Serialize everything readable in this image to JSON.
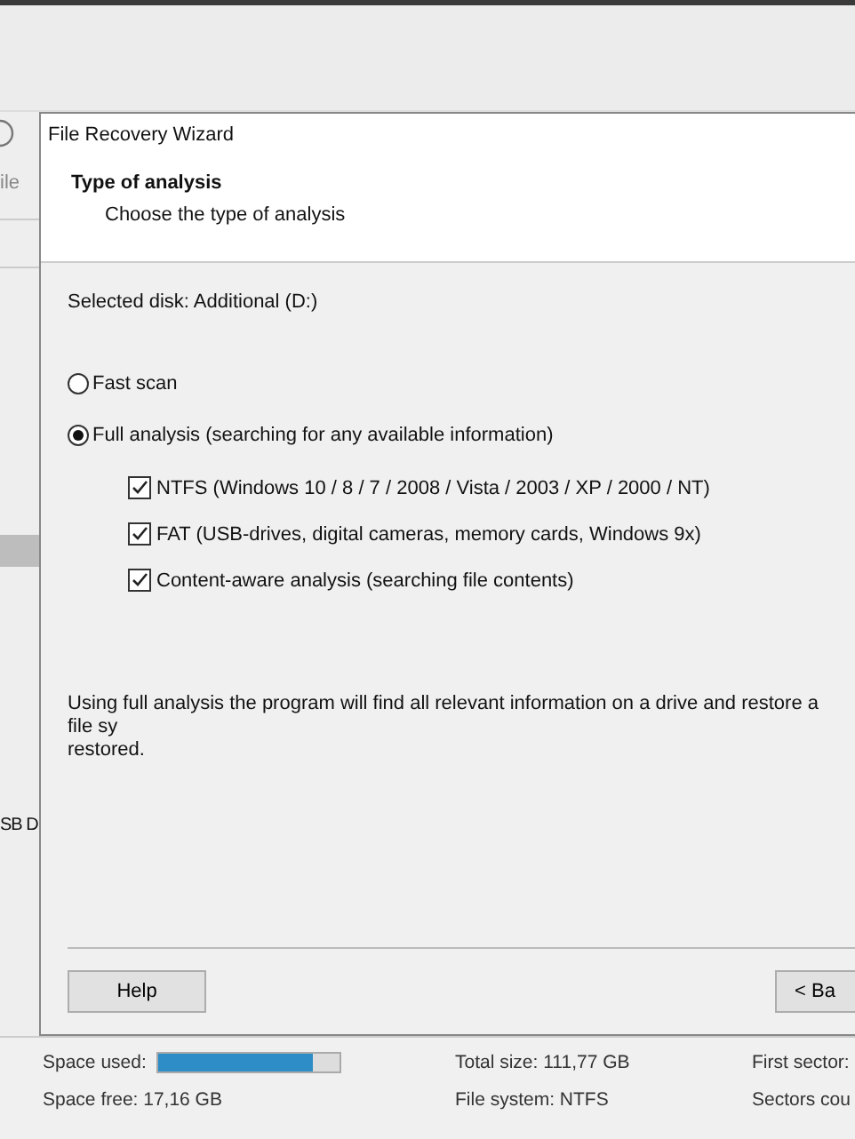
{
  "background": {
    "toolbar_text": "ile",
    "list_selected_row": true,
    "list_text": "SB D"
  },
  "dialog": {
    "title": "File Recovery Wizard",
    "heading": "Type of analysis",
    "subheading": "Choose the type of analysis",
    "selected_disk": "Selected disk: Additional (D:)",
    "options": [
      {
        "label": "Fast scan",
        "selected": false
      },
      {
        "label": "Full analysis (searching for any available information)",
        "selected": true
      }
    ],
    "filesystems": [
      {
        "label": "NTFS (Windows 10 / 8 / 7 / 2008 / Vista / 2003 / XP / 2000 / NT)",
        "checked": true
      },
      {
        "label": "FAT (USB-drives, digital cameras, memory cards, Windows 9x)",
        "checked": true
      },
      {
        "label": "Content-aware analysis (searching file contents)",
        "checked": true
      }
    ],
    "description": [
      "Using full analysis the program will find all relevant information on a drive and restore a file sy",
      "restored."
    ],
    "buttons": [
      "Help",
      "< Ba"
    ]
  },
  "status_bar": {
    "space_used_label": "Space used:",
    "space_used": {
      "level": 0.85
    },
    "total_size": "Total size: 111,77 GB",
    "first_sector": "First sector:",
    "space_free": "Space free: 17,16 GB",
    "file_system": "File system: NTFS",
    "sectors_count": "Sectors cou"
  }
}
